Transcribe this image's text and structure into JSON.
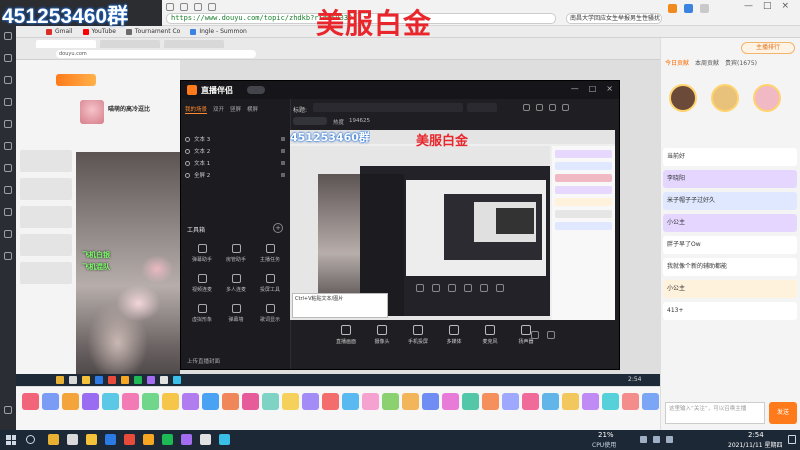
{
  "overlay": {
    "qq_group": "451253460群",
    "rank_label": "美服白金"
  },
  "browser": {
    "url": "https://www.douyu.com/topic/zhdkb?rid=59339",
    "search_text": "南昌大学回应女生举报男生性骚扰",
    "bookmarks": [
      {
        "label": "Gmail",
        "color": "#d93025"
      },
      {
        "label": "YouTube",
        "color": "#ff0000"
      },
      {
        "label": "Tournament Co",
        "color": "#6b6b6b"
      },
      {
        "label": "Ingle - Summon",
        "color": "#3a83e0"
      }
    ]
  },
  "inner_page": {
    "site": "douyu.com",
    "streamer_name": "喵萌的高冷逗比",
    "camera_tags": [
      "飞机白银",
      "飞机混队"
    ],
    "time": "2:54"
  },
  "tool": {
    "logo": "直播伴侣",
    "window_controls": [
      "—",
      "□",
      "×"
    ],
    "tabs": [
      "我的场景",
      "双开",
      "竖屏",
      "横屏"
    ],
    "sources": [
      "文本 3",
      "文本 2",
      "文本 1",
      "全屏 2"
    ],
    "toolbox_label": "工具箱",
    "toolbox_add": "+",
    "tools": [
      "弹幕助手",
      "房管助手",
      "主播任务",
      "视频连麦",
      "多人连麦",
      "投屏工具",
      "虚拟形象",
      "弹幕墙",
      "歌词显示"
    ],
    "footer": "上传直播封面",
    "title_label": "标题:",
    "heat_label": "热度",
    "heat_value": "194625",
    "hint": "Ctrl+V粘贴文本/图片",
    "bottom_buttons": [
      "直播画面",
      "摄像头",
      "手机投屏",
      "多媒体",
      "麦克风",
      "扬声器"
    ]
  },
  "side_panel": {
    "rank_button": "主播排行",
    "tabs": [
      "今日贡献",
      "本周贡献",
      "贵宾(1675)"
    ],
    "avatar_colors": [
      "#6b4a3a",
      "#e8c27a",
      "#f1b9c4"
    ],
    "chat": [
      {
        "text": "当前好",
        "bg": "#ffffff"
      },
      {
        "text": "李晓阳",
        "bg": "#e4d6ff"
      },
      {
        "text": "米子帽子子过好久",
        "bg": "#dfe8ff"
      },
      {
        "text": "小公主",
        "bg": "#e4d6ff"
      },
      {
        "text": "胖子早了Ow",
        "bg": "#ffffff"
      },
      {
        "text": "我就像个新的辅助都能",
        "bg": "#ffffff"
      },
      {
        "text": "小公主",
        "bg": "#fff2dc"
      },
      {
        "text": "413+",
        "bg": "#ffffff"
      }
    ],
    "input_placeholder": "这里输入“关注”，可以召唤主播",
    "send_label": "发送"
  },
  "gift_bar": {
    "colors": [
      "#f2647a",
      "#7a9cf5",
      "#f3a53b",
      "#9a6cf2",
      "#5bc8e6",
      "#f27bb6",
      "#6fd68a",
      "#f5c64a",
      "#b07cf0",
      "#4aa3f2",
      "#f0875a",
      "#e65b9a",
      "#7ed3c4",
      "#f5d15c",
      "#a38cf6",
      "#f36d6d",
      "#5ab9f0",
      "#f6a2d1",
      "#8bd16f",
      "#f2b55a",
      "#6f8df2",
      "#e97bd8",
      "#54c7a8",
      "#f5905c",
      "#9fa8ff",
      "#f06a9a",
      "#61b5e8",
      "#f2c75e",
      "#c08bf5",
      "#57d1d9",
      "#f48c8c",
      "#7aa6f5",
      "#f5b74a",
      "#a06ef0"
    ]
  },
  "taskbar": {
    "cpu_percent": "21%",
    "cpu_label": "CPU使用",
    "time": "2:54",
    "date": "2021/11/11 星期四",
    "app_colors": [
      "#e8b133",
      "#d9d9d9",
      "#f3c23a",
      "#2c7be5",
      "#e84b3a",
      "#f6a623",
      "#1db954",
      "#a46cf0",
      "#e2e2e2",
      "#3ac0e8"
    ]
  }
}
